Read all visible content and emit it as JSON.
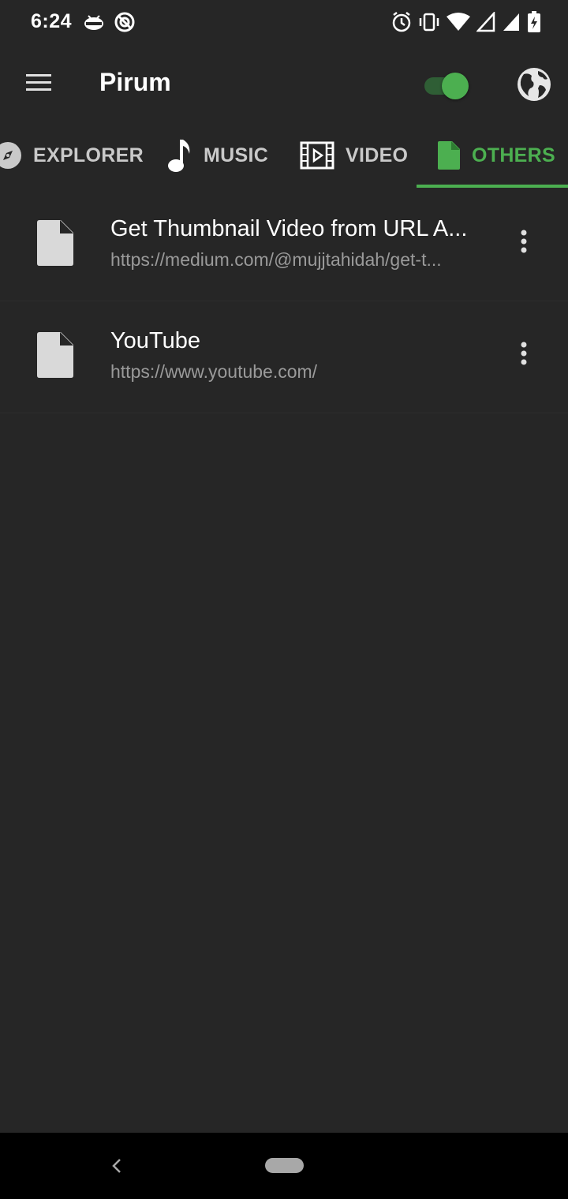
{
  "status_bar": {
    "time": "6:24",
    "left_icons": [
      "android-debug-icon",
      "no-disturb-icon"
    ],
    "right_icons": [
      "alarm-icon",
      "vibrate-icon",
      "wifi-icon",
      "signal-icon",
      "signal-icon",
      "battery-charging-icon"
    ]
  },
  "app_bar": {
    "title": "Pirum",
    "toggle_on": true,
    "accent_color": "#4caf50"
  },
  "tabs": [
    {
      "label": "EXPLORER",
      "icon": "compass-icon",
      "active": false
    },
    {
      "label": "MUSIC",
      "icon": "music-note-icon",
      "active": false
    },
    {
      "label": "VIDEO",
      "icon": "film-icon",
      "active": false
    },
    {
      "label": "OTHERS",
      "icon": "file-icon",
      "active": true
    }
  ],
  "items": [
    {
      "title": "Get Thumbnail Video from URL A...",
      "url": "https://medium.com/@mujjtahidah/get-t..."
    },
    {
      "title": "YouTube",
      "url": "https://www.youtube.com/"
    }
  ]
}
